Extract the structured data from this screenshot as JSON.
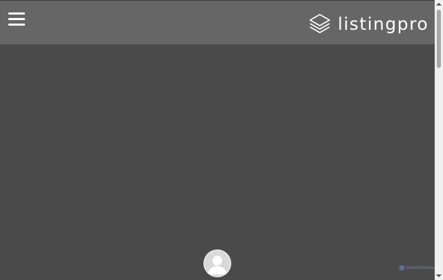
{
  "header": {
    "menu_icon": "hamburger-menu-icon",
    "logo_icon": "stacked-layers-icon",
    "logo_text": "listingpro"
  },
  "main": {
    "avatar_icon": "user-avatar-icon"
  },
  "watermark": {
    "text": "ScamMalware"
  },
  "scrollbar": {
    "up_icon": "arrow-up-icon",
    "down_icon": "arrow-down-icon"
  },
  "colors": {
    "header_bg": "#666666",
    "page_bg": "#4a4a4a",
    "logo_color": "#ffffff",
    "scrollbar_track": "#f0f0f0",
    "scrollbar_thumb": "#a8a8a8"
  }
}
